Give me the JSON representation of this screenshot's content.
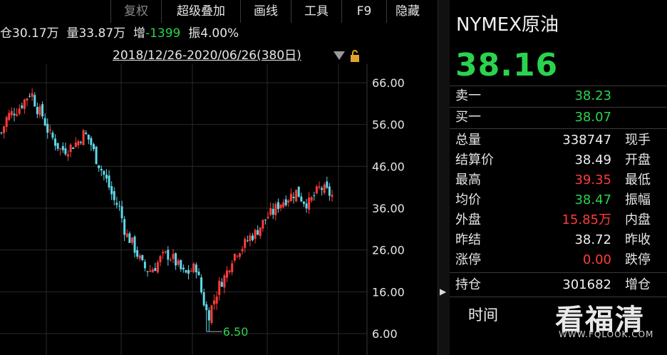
{
  "toolbar": {
    "items": [
      "复权",
      "超级叠加",
      "画线",
      "工具",
      "F9",
      "隐藏"
    ]
  },
  "infoline": {
    "position_prefix": "仓",
    "position_value": "30.17万",
    "volume_label": "量",
    "volume_value": "33.87万",
    "change_label": "增",
    "change_value": "-1399",
    "amplitude_label": "振",
    "amplitude_value": "4.00%"
  },
  "chart": {
    "date_range": "2018/12/26-2020/06/26(380日)",
    "min_label": "6.50",
    "colors": {
      "up": "#ff3b3b",
      "down": "#5fd8e8",
      "grid": "#2a2a2a"
    }
  },
  "chart_data": {
    "type": "candlestick",
    "yticks": [
      "66.00",
      "56.00",
      "46.00",
      "36.00",
      "26.00",
      "16.00",
      "6.00"
    ],
    "ylim": [
      6.0,
      66.0
    ],
    "close_path": [
      54,
      58,
      59,
      60,
      62,
      64,
      60,
      58,
      54,
      52,
      50,
      50,
      51,
      52,
      54,
      52,
      48,
      45,
      42,
      38,
      36,
      30,
      28,
      25,
      22,
      21,
      22,
      24,
      25,
      24,
      22,
      20,
      21,
      22,
      15,
      10,
      14,
      18,
      20,
      24,
      26,
      27,
      29,
      30,
      32,
      34,
      35,
      37,
      38,
      39,
      40,
      38,
      37,
      39,
      41,
      40,
      39
    ],
    "min_value": 6.5,
    "last_price": 38.16
  },
  "panel": {
    "name": "NYMEX原油",
    "price": "38.16",
    "sell1_label": "卖一",
    "sell1_value": "38.23",
    "buy1_label": "买一",
    "buy1_value": "38.07",
    "rows": [
      {
        "k": "总量",
        "v": "338747",
        "k2": "现手",
        "color": "white"
      },
      {
        "k": "结算价",
        "v": "38.49",
        "k2": "开盘",
        "color": "white"
      },
      {
        "k": "最高",
        "v": "39.35",
        "k2": "最低",
        "color": "red"
      },
      {
        "k": "均价",
        "v": "38.47",
        "k2": "振幅",
        "color": "green"
      },
      {
        "k": "外盘",
        "v": "15.85万",
        "k2": "内盘",
        "color": "red"
      },
      {
        "k": "昨结",
        "v": "38.72",
        "k2": "昨收",
        "color": "white"
      },
      {
        "k": "涨停",
        "v": "0.00",
        "k2": "跌停",
        "color": "red"
      }
    ],
    "hold_label": "持仓",
    "hold_value": "301682",
    "hold_k2": "增仓",
    "time_label": "时间"
  },
  "watermark": {
    "text": "看福清",
    "url": "WWW.FQLOOK.COM"
  }
}
